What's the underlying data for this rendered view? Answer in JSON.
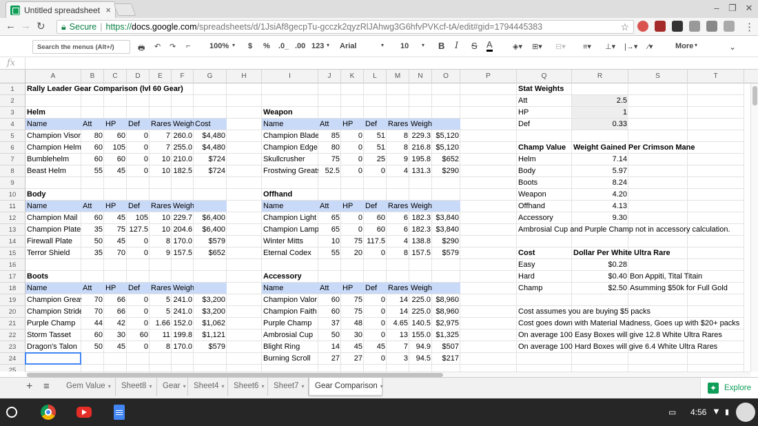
{
  "browser": {
    "tab_title": "Untitled spreadsheet - Go",
    "tab_close": "×",
    "secure_label": "Secure",
    "url_scheme": "https://",
    "url_host": "docs.google.com",
    "url_path": "/spreadsheets/d/1JsiAf8gecpTu-gcczk2qyzRlJAhwg3G6hfvPVKcf-tA/edit#gid=1794445383"
  },
  "toolbar": {
    "menu_search_placeholder": "Search the menus (Alt+/)",
    "zoom": "100%",
    "currency": "$",
    "percent": "%",
    "decimal_dec": ".0_",
    "decimal_inc": ".00",
    "number_format": "123",
    "font": "Arial",
    "font_size": "10",
    "bold": "B",
    "italic": "I",
    "strike": "S",
    "text_color": "A",
    "more": "More"
  },
  "formula_bar": {
    "fx": "fx",
    "value": ""
  },
  "columns": [
    "A",
    "B",
    "C",
    "D",
    "E",
    "F",
    "G",
    "H",
    "I",
    "J",
    "K",
    "L",
    "M",
    "N",
    "O",
    "P",
    "Q",
    "R",
    "S",
    "T"
  ],
  "rows": [
    "1",
    "2",
    "3",
    "4",
    "5",
    "6",
    "7",
    "8",
    "9",
    "10",
    "11",
    "12",
    "13",
    "14",
    "15",
    "16",
    "17",
    "18",
    "19",
    "20",
    "21",
    "22",
    "23",
    "24",
    "25"
  ],
  "cells": {
    "A1": "Rally Leader Gear Comparison (lvl 60 Gear)",
    "A3": "Helm",
    "A4": "Name",
    "B4": "Att",
    "C4": "HP",
    "D4": "Def",
    "E4": "Rares",
    "F4": "Weigh",
    "G4": "Cost",
    "A5": "Champion Visor",
    "B5": "80",
    "C5": "60",
    "D5": "0",
    "E5": "7",
    "F5": "260.0",
    "G5": "$4,480",
    "A6": "Champion Helm",
    "B6": "60",
    "C6": "105",
    "D6": "0",
    "E6": "7",
    "F6": "255.0",
    "G6": "$4,480",
    "A7": "Bumblehelm",
    "B7": "60",
    "C7": "60",
    "D7": "0",
    "E7": "10",
    "F7": "210.0",
    "G7": "$724",
    "A8": "Beast Helm",
    "B8": "55",
    "C8": "45",
    "D8": "0",
    "E8": "10",
    "F8": "182.5",
    "G8": "$724",
    "A10": "Body",
    "A11": "Name",
    "B11": "Att",
    "C11": "HP",
    "D11": "Def",
    "E11": "Rares",
    "F11": "Weight",
    "A12": "Champion Mail",
    "B12": "60",
    "C12": "45",
    "D12": "105",
    "E12": "10",
    "F12": "229.7",
    "G12": "$6,400",
    "A13": "Champion Plate",
    "B13": "35",
    "C13": "75",
    "D13": "127.5",
    "E13": "10",
    "F13": "204.6",
    "G13": "$6,400",
    "A14": "Firewall Plate",
    "B14": "50",
    "C14": "45",
    "D14": "0",
    "E14": "8",
    "F14": "170.0",
    "G14": "$579",
    "A15": "Terror Shield",
    "B15": "35",
    "C15": "70",
    "D15": "0",
    "E15": "9",
    "F15": "157.5",
    "G15": "$652",
    "A17": "Boots",
    "A18": "Name",
    "B18": "Att",
    "C18": "HP",
    "D18": "Def",
    "E18": "Rares",
    "F18": "Weight",
    "A19": "Champion Greav",
    "B19": "70",
    "C19": "66",
    "D19": "0",
    "E19": "5",
    "F19": "241.0",
    "G19": "$3,200",
    "A20": "Champion Stride",
    "B20": "70",
    "C20": "66",
    "D20": "0",
    "E20": "5",
    "F20": "241.0",
    "G20": "$3,200",
    "A21": "Purple Champ",
    "B21": "44",
    "C21": "42",
    "D21": "0",
    "E21": "1.66",
    "F21": "152.0",
    "G21": "$1,062",
    "A22": "Storm Tasset",
    "B22": "60",
    "C22": "30",
    "D22": "60",
    "E22": "11",
    "F22": "199.8",
    "G22": "$1,121",
    "A23": "Dragon's Talon",
    "B23": "50",
    "C23": "45",
    "D23": "0",
    "E23": "8",
    "F23": "170.0",
    "G23": "$579",
    "I3": "Weapon",
    "I4": "Name",
    "J4": "Att",
    "K4": "HP",
    "L4": "Def",
    "M4": "Rares",
    "N4": "Weight",
    "I5": "Champion Blade",
    "J5": "85",
    "K5": "0",
    "L5": "51",
    "M5": "8",
    "N5": "229.3",
    "O5": "$5,120",
    "I6": "Champion Edge",
    "J6": "80",
    "K6": "0",
    "L6": "51",
    "M6": "8",
    "N6": "216.8",
    "O6": "$5,120",
    "I7": "Skullcrusher",
    "J7": "75",
    "K7": "0",
    "L7": "25",
    "M7": "9",
    "N7": "195.8",
    "O7": "$652",
    "I8": "Frostwing Greats",
    "J8": "52.5",
    "K8": "0",
    "L8": "0",
    "M8": "4",
    "N8": "131.3",
    "O8": "$290",
    "I10": "Offhand",
    "I11": "Name",
    "J11": "Att",
    "K11": "HP",
    "L11": "Def",
    "M11": "Rares",
    "N11": "Weight",
    "I12": "Champion Light",
    "J12": "65",
    "K12": "0",
    "L12": "60",
    "M12": "6",
    "N12": "182.3",
    "O12": "$3,840",
    "I13": "Champion Lamp",
    "J13": "65",
    "K13": "0",
    "L13": "60",
    "M13": "6",
    "N13": "182.3",
    "O13": "$3,840",
    "I14": "Winter Mitts",
    "J14": "10",
    "K14": "75",
    "L14": "117.5",
    "M14": "4",
    "N14": "138.8",
    "O14": "$290",
    "I15": "Eternal Codex",
    "J15": "55",
    "K15": "20",
    "L15": "0",
    "M15": "8",
    "N15": "157.5",
    "O15": "$579",
    "I17": "Accessory",
    "I18": "Name",
    "J18": "Att",
    "K18": "HP",
    "L18": "Def",
    "M18": "Rares",
    "N18": "Weight",
    "I19": "Champion Valor",
    "J19": "60",
    "K19": "75",
    "L19": "0",
    "M19": "14",
    "N19": "225.0",
    "O19": "$8,960",
    "I20": "Champion Faith",
    "J20": "60",
    "K20": "75",
    "L20": "0",
    "M20": "14",
    "N20": "225.0",
    "O20": "$8,960",
    "I21": "Purple Champ",
    "J21": "37",
    "K21": "48",
    "L21": "0",
    "M21": "4.65",
    "N21": "140.5",
    "O21": "$2,975",
    "I22": "Ambrosial Cup",
    "J22": "50",
    "K22": "30",
    "L22": "0",
    "M22": "13",
    "N22": "155.0",
    "O22": "$1,325",
    "I23": "Blight Ring",
    "J23": "14",
    "K23": "45",
    "L23": "45",
    "M23": "7",
    "N23": "94.9",
    "O23": "$507",
    "I24": "Burning Scroll",
    "J24": "27",
    "K24": "27",
    "L24": "0",
    "M24": "3",
    "N24": "94.5",
    "O24": "$217",
    "Q1": "Stat Weights",
    "Q2": "Att",
    "R2": "2.5",
    "Q3": "HP",
    "R3": "1",
    "Q4": "Def",
    "R4": "0.33",
    "Q6": "Champ Value",
    "R6": "Weight Gained Per Crimson Mane",
    "Q7": "Helm",
    "R7": "7.14",
    "Q8": "Body",
    "R8": "5.97",
    "Q9": "Boots",
    "R9": "8.24",
    "Q10": "Weapon",
    "R10": "4.20",
    "Q11": "Offhand",
    "R11": "4.13",
    "Q12": "Accessory",
    "R12": "9.30",
    "Q13": "Ambrosial Cup and Purple Champ not in accessory calculation.",
    "Q15": "Cost",
    "R15": "Dollar Per White Ultra Rare",
    "Q16": "Easy",
    "R16": "$0.28",
    "Q17": "Hard",
    "R17": "$0.40",
    "S17": "Bon Appiti, Tital Titain",
    "Q18": "Champ",
    "R18": "$2.50",
    "S18": "Asumming $50k for Full Gold",
    "Q20": "Cost assumes you are buying $5 packs",
    "Q21": "Cost goes down with Material Madness, Goes up with $20+ packs",
    "Q22": "On average 100 Easy Boxes will give 12.8 White Ultra Rares",
    "Q23": "On average 100 Hard Boxes will give 6.4 White Ultra Rares"
  },
  "sheets": [
    "Gem Value",
    "Sheet8",
    "Gear",
    "Sheet4",
    "Sheet6",
    "Sheet7",
    "Gear Comparison"
  ],
  "active_sheet": "Gear Comparison",
  "explore_label": "Explore",
  "taskbar": {
    "clock": "4:56"
  },
  "colors": {
    "header_fill": "#c9daf8",
    "weight_fill": "#eeeeee",
    "selection": "#4285f4",
    "sheets_green": "#0f9d58"
  }
}
